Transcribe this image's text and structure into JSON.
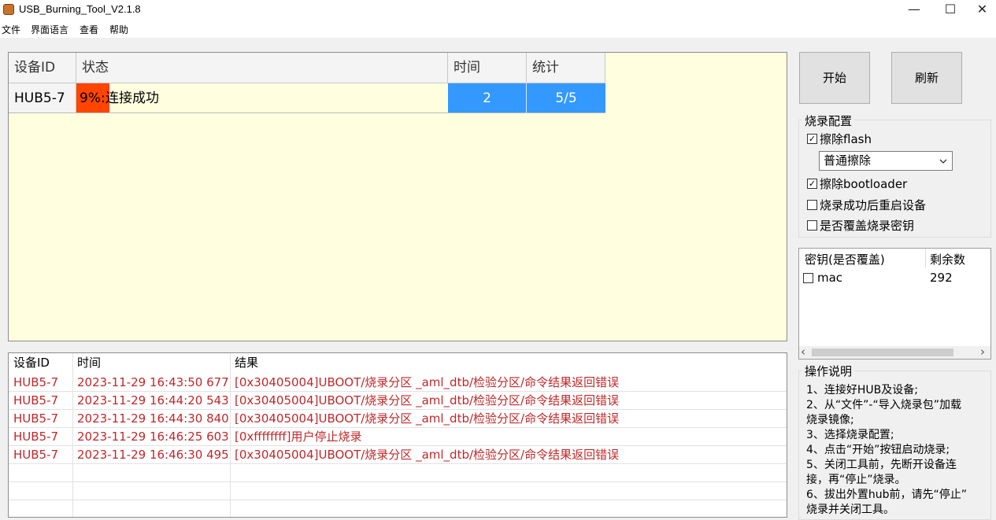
{
  "window": {
    "title": "USB_Burning_Tool_V2.1.8",
    "minimize": "—",
    "maximize": "☐",
    "close": "✕"
  },
  "menu": {
    "items": [
      "文件",
      "界面语言",
      "查看",
      "帮助"
    ]
  },
  "device_grid": {
    "headers": [
      "设备ID",
      "状态",
      "时间",
      "统计"
    ],
    "rows": [
      {
        "id": "HUB5-7",
        "progress_text": "9%:",
        "status": "连接成功",
        "progress_pct": 9,
        "time": "2",
        "count": "5/5"
      }
    ]
  },
  "controls": {
    "start": "开始",
    "refresh": "刷新"
  },
  "burn_config": {
    "title": "烧录配置",
    "erase_flash": {
      "label": "擦除flash",
      "checked": true
    },
    "erase_mode": "普通擦除",
    "erase_bootloader": {
      "label": "擦除bootloader",
      "checked": true
    },
    "reboot_after": {
      "label": "烧录成功后重启设备",
      "checked": false
    },
    "overwrite_keys": {
      "label": "是否覆盖烧录密钥",
      "checked": false
    }
  },
  "key_table": {
    "headers": [
      "密钥(是否覆盖)",
      "剩余数"
    ],
    "rows": [
      {
        "name": "mac",
        "remaining": "292",
        "checked": false
      }
    ],
    "scroll_left": "‹",
    "scroll_right": "›"
  },
  "log_table": {
    "headers": [
      "设备ID",
      "时间",
      "结果"
    ],
    "rows": [
      {
        "id": "HUB5-7",
        "time": "2023-11-29 16:43:50 677",
        "result": "[0x30405004]UBOOT/烧录分区 _aml_dtb/检验分区/命令结果返回错误"
      },
      {
        "id": "HUB5-7",
        "time": "2023-11-29 16:44:20 543",
        "result": "[0x30405004]UBOOT/烧录分区 _aml_dtb/检验分区/命令结果返回错误"
      },
      {
        "id": "HUB5-7",
        "time": "2023-11-29 16:44:30 840",
        "result": "[0x30405004]UBOOT/烧录分区 _aml_dtb/检验分区/命令结果返回错误"
      },
      {
        "id": "HUB5-7",
        "time": "2023-11-29 16:46:25 603",
        "result": "[0xffffffff]用户停止烧录"
      },
      {
        "id": "HUB5-7",
        "time": "2023-11-29 16:46:30 495",
        "result": "[0x30405004]UBOOT/烧录分区 _aml_dtb/检验分区/命令结果返回错误"
      }
    ]
  },
  "instructions": {
    "title": "操作说明",
    "lines": [
      "1、连接好HUB及设备;",
      "2、从“文件”-“导入烧录包”加载",
      "烧录镜像;",
      "3、选择烧录配置;",
      "4、点击“开始”按钮启动烧录;",
      "5、关闭工具前，先断开设备连",
      "接，再“停止”烧录。",
      "6、拔出外置hub前，请先“停止”",
      "烧录并关闭工具。"
    ]
  },
  "colors": {
    "grid_bg": "#ffffe0",
    "progress": "#ff4500",
    "cell_blue": "#3399ff",
    "error_text": "#c0282a"
  }
}
